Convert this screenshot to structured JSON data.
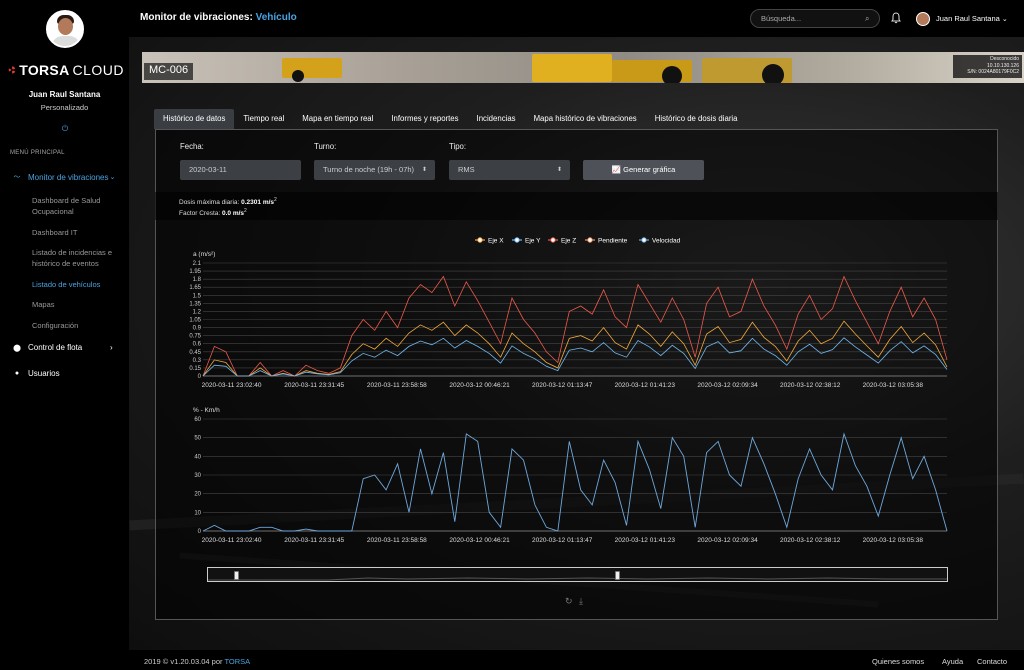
{
  "app": {
    "title_prefix": "Monitor de vibraciones: ",
    "title_highlight": "Vehículo"
  },
  "sidebar": {
    "logo_bold": "TORSA",
    "logo_light": "CLOUD",
    "user_name": "Juan Raul Santana",
    "user_role": "Personalizado",
    "menu_title": "MENÚ PRINCIPAL",
    "nav": [
      {
        "label": "Monitor de vibraciones",
        "icon": "wave-icon"
      },
      {
        "label": "Control de flota",
        "icon": "location-pin-icon"
      },
      {
        "label": "Usuarios",
        "icon": "user-icon"
      }
    ],
    "sub_items": [
      {
        "label": "Dashboard de Salud Ocupacional"
      },
      {
        "label": "Dashboard IT"
      },
      {
        "label": "Listado de incidencias e histórico de eventos"
      },
      {
        "label": "Listado de vehículos"
      },
      {
        "label": "Mapas"
      },
      {
        "label": "Configuración"
      }
    ]
  },
  "header": {
    "search_placeholder": "Búsqueda...",
    "user_name": "Juan Raul Santana"
  },
  "banner": {
    "title": "MC-006",
    "info_lines": [
      "Desconocido",
      "10.10.130.126",
      "S/N: 0024A80179F0C2"
    ]
  },
  "tabs": [
    {
      "label": "Histórico de datos",
      "active": true
    },
    {
      "label": "Tiempo real"
    },
    {
      "label": "Mapa en tiempo real"
    },
    {
      "label": "Informes y reportes"
    },
    {
      "label": "Incidencias"
    },
    {
      "label": "Mapa histórico de vibraciones"
    },
    {
      "label": "Histórico de dosis diaria"
    }
  ],
  "form": {
    "fecha_label": "Fecha:",
    "fecha_value": "2020-03-11",
    "turno_label": "Turno:",
    "turno_value": "Turno de noche (19h - 07h)",
    "tipo_label": "Tipo:",
    "tipo_value": "RMS",
    "generate_label": "Generar gráfica"
  },
  "stats": {
    "dosis_label": "Dosis máxima diaria: ",
    "dosis_value": "0.2301 m/s",
    "factor_label": "Factor Cresta: ",
    "factor_value": "0.0 m/s",
    "unit_exp": "2"
  },
  "colors": {
    "accent": "#4aa3e0",
    "eje_x": "#f4a93c",
    "eje_y": "#6fb8ee",
    "eje_z": "#ee5a4a",
    "pendiente": "#f0905c",
    "velocidad": "#6fa8dc"
  },
  "chart_data": [
    {
      "type": "line",
      "ylabel": "a (m/s²)",
      "ylim": [
        0,
        2.1
      ],
      "yticks": [
        "0",
        "0.15",
        "0.3",
        "0.45",
        "0.6",
        "0.75",
        "0.9",
        "1.05",
        "1.2",
        "1.35",
        "1.5",
        "1.65",
        "1.8",
        "1.95",
        "2.1"
      ],
      "x_ticks": [
        "2020-03-11 23:02:40",
        "2020-03-11 23:31:45",
        "2020-03-11 23:58:58",
        "2020-03-12 00:46:21",
        "2020-03-12 01:13:47",
        "2020-03-12 01:41:23",
        "2020-03-12 02:09:34",
        "2020-03-12 02:38:12",
        "2020-03-12 03:05:38"
      ],
      "legend": [
        "Eje X",
        "Eje Y",
        "Eje Z",
        "Pendiente",
        "Velocidad"
      ],
      "series": [
        {
          "name": "Eje Z",
          "values": [
            0,
            0.55,
            0.45,
            0,
            0,
            0.25,
            0,
            0.1,
            0,
            0.2,
            0.1,
            0.05,
            0.15,
            0.75,
            1.05,
            0.85,
            1.2,
            0.9,
            1.45,
            1.7,
            1.55,
            1.85,
            1.3,
            1.75,
            1.4,
            1.0,
            0.6,
            1.45,
            1.05,
            0.8,
            0.45,
            0.25,
            1.2,
            1.3,
            1.15,
            1.6,
            1.1,
            0.9,
            1.7,
            1.35,
            1.0,
            1.45,
            1.05,
            0.35,
            1.35,
            1.65,
            1.1,
            1.2,
            1.8,
            1.3,
            0.95,
            0.5,
            1.15,
            1.5,
            1.05,
            1.25,
            1.85,
            1.4,
            1.0,
            0.6,
            1.2,
            1.65,
            1.1,
            1.45,
            1.05,
            0.3
          ]
        },
        {
          "name": "Eje X",
          "values": [
            0,
            0.3,
            0.25,
            0,
            0,
            0.15,
            0,
            0.05,
            0,
            0.1,
            0.05,
            0.03,
            0.08,
            0.4,
            0.6,
            0.5,
            0.7,
            0.55,
            0.8,
            0.95,
            0.85,
            1.0,
            0.75,
            0.95,
            0.8,
            0.6,
            0.35,
            0.8,
            0.6,
            0.45,
            0.25,
            0.15,
            0.7,
            0.75,
            0.65,
            0.9,
            0.62,
            0.5,
            0.95,
            0.78,
            0.55,
            0.82,
            0.6,
            0.2,
            0.78,
            0.92,
            0.62,
            0.68,
            1.0,
            0.72,
            0.55,
            0.28,
            0.65,
            0.85,
            0.6,
            0.7,
            1.02,
            0.78,
            0.56,
            0.35,
            0.68,
            0.92,
            0.62,
            0.8,
            0.58,
            0.17
          ]
        },
        {
          "name": "Eje Y",
          "values": [
            0,
            0.2,
            0.18,
            0,
            0,
            0.1,
            0,
            0.04,
            0,
            0.07,
            0.04,
            0.02,
            0.06,
            0.28,
            0.42,
            0.35,
            0.48,
            0.38,
            0.55,
            0.65,
            0.58,
            0.7,
            0.52,
            0.66,
            0.55,
            0.42,
            0.24,
            0.56,
            0.42,
            0.32,
            0.18,
            0.1,
            0.48,
            0.52,
            0.45,
            0.62,
            0.43,
            0.35,
            0.66,
            0.54,
            0.38,
            0.57,
            0.42,
            0.14,
            0.54,
            0.64,
            0.43,
            0.47,
            0.7,
            0.5,
            0.38,
            0.2,
            0.45,
            0.59,
            0.42,
            0.49,
            0.71,
            0.54,
            0.39,
            0.24,
            0.47,
            0.64,
            0.43,
            0.56,
            0.4,
            0.12
          ]
        }
      ]
    },
    {
      "type": "line",
      "ylabel": "% - Km/h",
      "ylim": [
        0,
        60
      ],
      "yticks": [
        "0",
        "10",
        "20",
        "30",
        "40",
        "50",
        "60"
      ],
      "x_ticks": [
        "2020-03-11 23:02:40",
        "2020-03-11 23:31:45",
        "2020-03-11 23:58:58",
        "2020-03-12 00:46:21",
        "2020-03-12 01:13:47",
        "2020-03-12 01:41:23",
        "2020-03-12 02:09:34",
        "2020-03-12 02:38:12",
        "2020-03-12 03:05:38"
      ],
      "series": [
        {
          "name": "Velocidad",
          "values": [
            0,
            3,
            0,
            0,
            0,
            2,
            2,
            0,
            0,
            1,
            0,
            0,
            0,
            0,
            28,
            30,
            22,
            36,
            10,
            44,
            20,
            42,
            5,
            52,
            48,
            10,
            2,
            44,
            38,
            14,
            2,
            0,
            48,
            22,
            14,
            38,
            26,
            3,
            48,
            33,
            12,
            50,
            40,
            2,
            42,
            48,
            30,
            24,
            50,
            36,
            20,
            2,
            28,
            44,
            30,
            22,
            52,
            35,
            24,
            8,
            30,
            50,
            28,
            40,
            22,
            0
          ]
        }
      ]
    }
  ]
}
